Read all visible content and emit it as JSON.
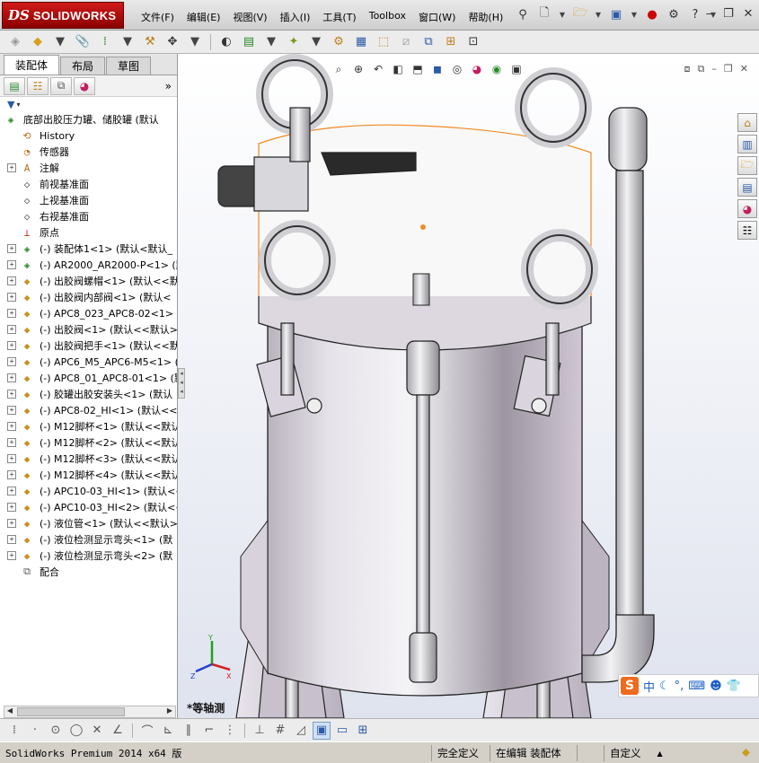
{
  "app": {
    "brand_prefix": "DS",
    "brand_name": "SOLIDWORKS"
  },
  "menu": [
    "文件(F)",
    "编辑(E)",
    "视图(V)",
    "插入(I)",
    "工具(T)",
    "Toolbox",
    "窗口(W)",
    "帮助(H)"
  ],
  "tabs": [
    "装配体",
    "布局",
    "草图"
  ],
  "active_tab": "装配体",
  "tree": {
    "root_label": "底部出胶压力罐、储胶罐  (默认",
    "items": [
      {
        "label": "History",
        "icon": "history-icon",
        "exp": false
      },
      {
        "label": "传感器",
        "icon": "sensor-icon",
        "exp": false
      },
      {
        "label": "注解",
        "icon": "annotation-icon",
        "exp": true
      },
      {
        "label": "前视基准面",
        "icon": "plane-icon",
        "exp": false
      },
      {
        "label": "上视基准面",
        "icon": "plane-icon",
        "exp": false
      },
      {
        "label": "右视基准面",
        "icon": "plane-icon",
        "exp": false
      },
      {
        "label": "原点",
        "icon": "origin-icon",
        "exp": false
      },
      {
        "label": "(-) 装配体1<1> (默认<默认_",
        "icon": "subassembly-icon",
        "exp": true
      },
      {
        "label": "(-) AR2000_AR2000-P<1> (默",
        "icon": "subassembly-icon",
        "exp": true
      },
      {
        "label": "(-) 出胶阀螺帽<1> (默认<<默",
        "icon": "part-icon",
        "exp": true
      },
      {
        "label": "(-) 出胶阀内部阀<1> (默认<",
        "icon": "part-icon",
        "exp": true
      },
      {
        "label": "(-) APC8_023_APC8-02<1> (默",
        "icon": "part-icon",
        "exp": true
      },
      {
        "label": "(-) 出胶阀<1> (默认<<默认>_",
        "icon": "part-icon",
        "exp": true
      },
      {
        "label": "(-) 出胶阀把手<1> (默认<<默",
        "icon": "part-icon",
        "exp": true
      },
      {
        "label": "(-) APC6_M5_APC6-M5<1> (默",
        "icon": "part-icon",
        "exp": true
      },
      {
        "label": "(-) APC8_01_APC8-01<1> (默",
        "icon": "part-icon",
        "exp": true
      },
      {
        "label": "(-) 胶罐出胶安装头<1> (默认",
        "icon": "part-icon",
        "exp": true
      },
      {
        "label": "(-) APC8-02_HI<1> (默认<<默",
        "icon": "part-icon",
        "exp": true
      },
      {
        "label": "(-) M12脚杯<1> (默认<<默认>",
        "icon": "part-icon",
        "exp": true
      },
      {
        "label": "(-) M12脚杯<2> (默认<<默认>",
        "icon": "part-icon",
        "exp": true
      },
      {
        "label": "(-) M12脚杯<3> (默认<<默认>",
        "icon": "part-icon",
        "exp": true
      },
      {
        "label": "(-) M12脚杯<4> (默认<<默认>",
        "icon": "part-icon",
        "exp": true
      },
      {
        "label": "(-) APC10-03_HI<1> (默认<<",
        "icon": "part-icon",
        "exp": true
      },
      {
        "label": "(-) APC10-03_HI<2> (默认<<",
        "icon": "part-icon",
        "exp": true
      },
      {
        "label": "(-) 液位管<1> (默认<<默认>_",
        "icon": "part-icon",
        "exp": true
      },
      {
        "label": "(-) 液位检测显示弯头<1> (默",
        "icon": "part-icon",
        "exp": true
      },
      {
        "label": "(-) 液位检测显示弯头<2> (默",
        "icon": "part-icon",
        "exp": true
      },
      {
        "label": "配合",
        "icon": "mates-icon",
        "exp": false
      }
    ]
  },
  "viewport": {
    "view_name": "*等轴测"
  },
  "ime": {
    "logo": "S",
    "mode": "中"
  },
  "status": {
    "product": "SolidWorks Premium 2014 x64 版",
    "definition": "完全定义",
    "mode": "在编辑 装配体",
    "units": "自定义",
    "units_arrow": "▲"
  },
  "colors": {
    "brand_red": "#c4161c",
    "selection_orange": "#f08a24",
    "ime_orange": "#f06a1d",
    "triad_x": "#d02020",
    "triad_y": "#20a020",
    "triad_z": "#2040d0"
  }
}
